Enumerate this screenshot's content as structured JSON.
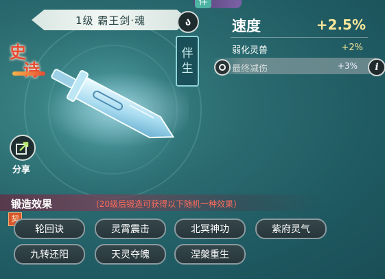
{
  "item": {
    "name": "1级  霸王剑·魂",
    "rarity": "史诗",
    "companion_tag": [
      "伴",
      "生"
    ],
    "lock_symbol": "ა",
    "top_tag_char": "伴"
  },
  "stats": {
    "main": {
      "label": "速度",
      "value": "+2.5%"
    },
    "rows": [
      {
        "label": "弱化灵兽",
        "value": "+2%",
        "locked": false
      },
      {
        "label": "最终减伤",
        "value": "+3%",
        "locked": true
      }
    ],
    "info_symbol": "i"
  },
  "share": {
    "label": "分享"
  },
  "forge": {
    "title": "锻造效果",
    "hint": "(20级后锻造可获得以下随机一种效果)",
    "contract_badge": "契",
    "effects": [
      "轮回诀",
      "灵霄震击",
      "北冥神功",
      "紫府灵气",
      "九转还阳",
      "天灵夺魄",
      "涅槃重生"
    ]
  },
  "colors": {
    "background": "#2a6b70",
    "value_yellow": "#f6e79a",
    "hint_red": "#ff6b5c",
    "epic_red": "#e74c33"
  }
}
